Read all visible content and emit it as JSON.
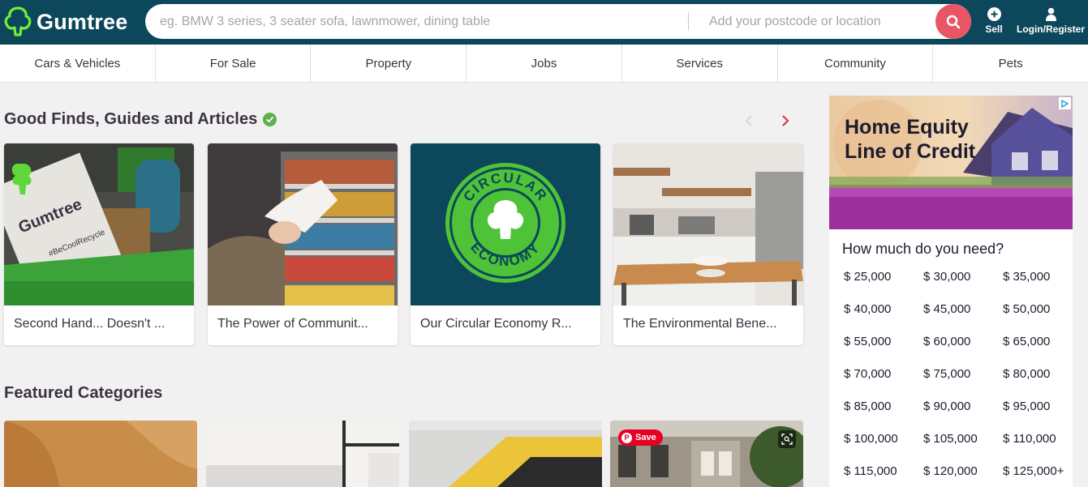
{
  "header": {
    "logo_text": "Gumtree",
    "search_placeholder": "eg. BMW 3 series, 3 seater sofa, lawnmower, dining table",
    "location_placeholder": "Add your postcode or location",
    "sell_label": "Sell",
    "login_label": "Login/Register"
  },
  "nav": {
    "items": [
      "Cars & Vehicles",
      "For Sale",
      "Property",
      "Jobs",
      "Services",
      "Community",
      "Pets"
    ]
  },
  "good_finds": {
    "title": "Good Finds, Guides and Articles",
    "articles": [
      {
        "title": "Second Hand... Doesn't ..."
      },
      {
        "title": "The Power of Communit..."
      },
      {
        "title": "Our Circular Economy R..."
      },
      {
        "title": "The Environmental Bene..."
      }
    ],
    "recycle_sign_brand": "Gumtree",
    "recycle_sign_tag": "#BeCoolRecycle",
    "badge_top": "CIRCULAR",
    "badge_bottom": "ECONOMY"
  },
  "featured": {
    "title": "Featured Categories",
    "save_label": "Save"
  },
  "ad": {
    "headline": "Home Equity Line of Credit",
    "question": "How much do you need?",
    "amounts": [
      "$ 25,000",
      "$ 30,000",
      "$ 35,000",
      "$ 40,000",
      "$ 45,000",
      "$ 50,000",
      "$ 55,000",
      "$ 60,000",
      "$ 65,000",
      "$ 70,000",
      "$ 75,000",
      "$ 80,000",
      "$ 85,000",
      "$ 90,000",
      "$ 95,000",
      "$ 100,000",
      "$ 105,000",
      "$ 110,000",
      "$ 115,000",
      "$ 120,000",
      "$ 125,000+"
    ]
  },
  "colors": {
    "header_bg": "#0d475c",
    "search_button": "#e85565",
    "carousel_next": "#d43a4c",
    "verified": "#5cb14c",
    "brand_green": "#72ef36"
  },
  "icons": [
    "tree-logo-icon",
    "search-icon",
    "plus-circle-icon",
    "user-icon",
    "verified-check-icon",
    "chevron-left-icon",
    "chevron-right-icon",
    "pinterest-icon",
    "visual-search-icon",
    "ad-choices-icon"
  ]
}
